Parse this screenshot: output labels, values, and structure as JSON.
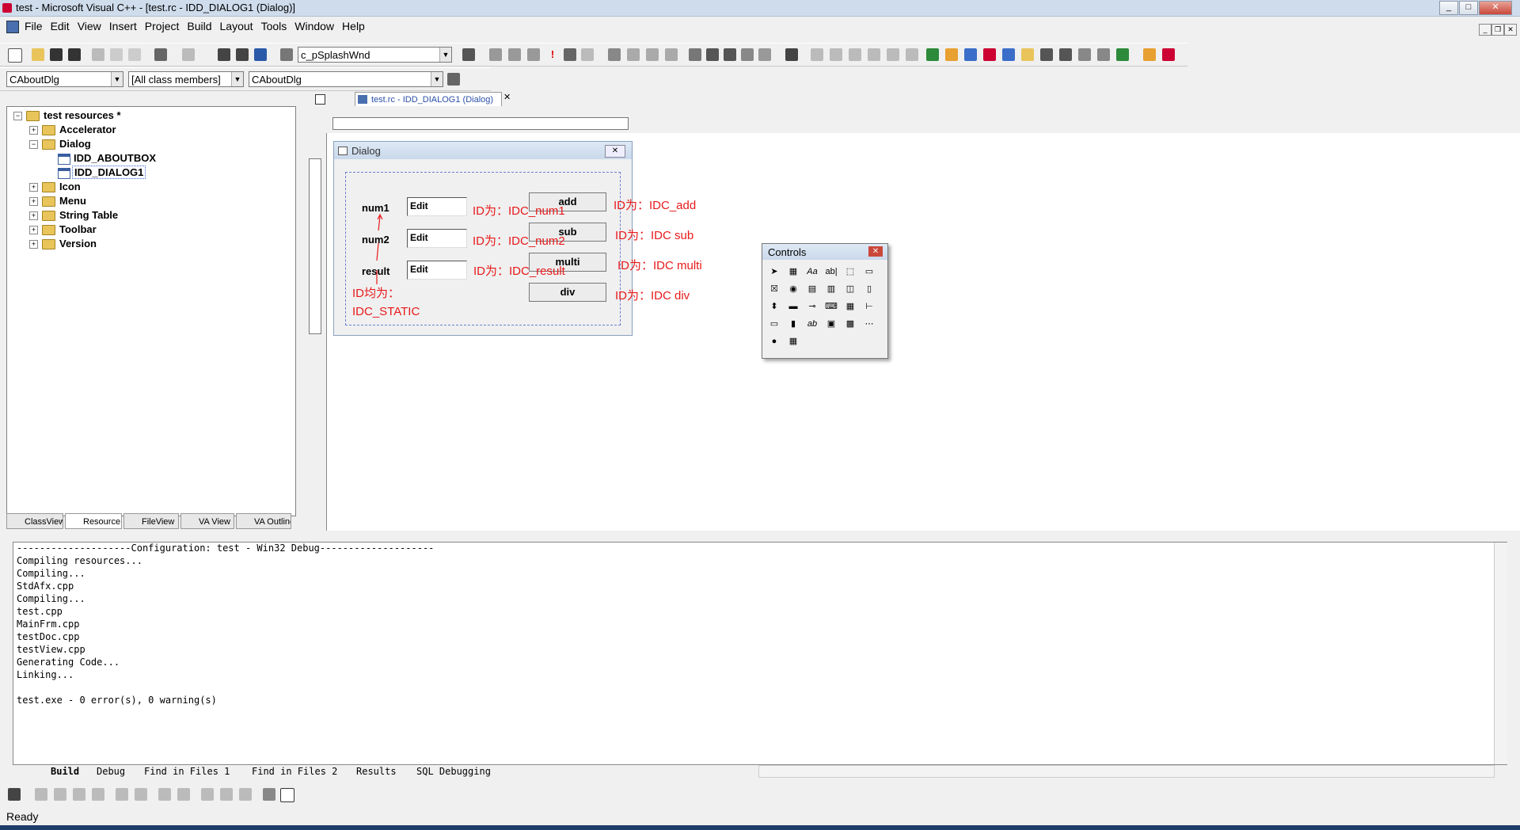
{
  "window": {
    "title": "test - Microsoft Visual C++ - [test.rc - IDD_DIALOG1 (Dialog)]"
  },
  "menu": [
    "File",
    "Edit",
    "View",
    "Insert",
    "Project",
    "Build",
    "Layout",
    "Tools",
    "Window",
    "Help"
  ],
  "toolbar": {
    "search_combo": "c_pSplashWnd"
  },
  "wizardbar": {
    "class_combo": "CAboutDlg",
    "filter_combo": "[All class members]",
    "member_combo": "CAboutDlg"
  },
  "document_tab": "test.rc - IDD_DIALOG1 (Dialog)",
  "tree": {
    "root": "test resources *",
    "items": [
      "Accelerator",
      "Dialog",
      "IDD_ABOUTBOX",
      "IDD_DIALOG1",
      "Icon",
      "Menu",
      "String Table",
      "Toolbar",
      "Version"
    ]
  },
  "panel_tabs": [
    "ClassView",
    "Resource",
    "FileView",
    "VA View",
    "VA Outline"
  ],
  "dialog": {
    "title": "Dialog",
    "labels": [
      "num1",
      "num2",
      "result"
    ],
    "edits": [
      "Edit",
      "Edit",
      "Edit"
    ],
    "buttons": [
      "add",
      "sub",
      "multi",
      "div"
    ]
  },
  "annotations": {
    "num1": "ID为：IDC_num1",
    "num2": "ID为：IDC_num2",
    "result": "ID为：IDC_result",
    "add": "ID为：IDC_add",
    "sub": "ID为：IDC  sub",
    "multi": "ID为：IDC  multi",
    "div": "ID为：IDC  div",
    "static1": "ID均为：",
    "static2": "IDC_STATIC"
  },
  "controls_palette": {
    "title": "Controls"
  },
  "output": {
    "lines": [
      "--------------------Configuration: test - Win32 Debug--------------------",
      "Compiling resources...",
      "Compiling...",
      "StdAfx.cpp",
      "Compiling...",
      "test.cpp",
      "MainFrm.cpp",
      "testDoc.cpp",
      "testView.cpp",
      "Generating Code...",
      "Linking...",
      "",
      "test.exe - 0 error(s), 0 warning(s)"
    ],
    "tabs": [
      "Build",
      "Debug",
      "Find in Files 1",
      "Find in Files 2",
      "Results",
      "SQL Debugging"
    ]
  },
  "status": {
    "text": "Ready"
  },
  "colors": {
    "annotation": "#e8191a",
    "selection": "#3366cc"
  }
}
